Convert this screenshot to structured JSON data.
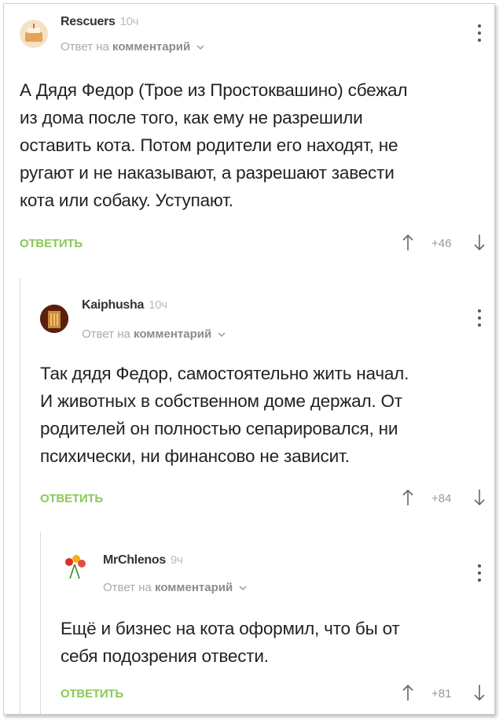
{
  "comments": [
    {
      "author": "Rescuers",
      "time": "10ч",
      "reply_prefix": "Ответ на",
      "reply_target": "комментарий",
      "lines": [
        "А Дядя Федор (Трое из Простоквашино) сбежал",
        "из дома после того, как ему не разрешили",
        "оставить кота. Потом родители его находят, не",
        "ругают и не наказывают, а разрешают завести",
        "кота или собаку. Уступают."
      ],
      "reply_label": "ОТВЕТИТЬ",
      "rating": "+46"
    },
    {
      "author": "Kaiphusha",
      "time": "10ч",
      "reply_prefix": "Ответ на",
      "reply_target": "комментарий",
      "lines": [
        "Так дядя Федор, самостоятельно жить начал.",
        "И животных в собственном доме держал. От",
        "родителей он полностью сепарировался, ни",
        "психически, ни финансово не зависит."
      ],
      "reply_label": "ОТВЕТИТЬ",
      "rating": "+84"
    },
    {
      "author": "MrChlenos",
      "time": "9ч",
      "reply_prefix": "Ответ на",
      "reply_target": "комментарий",
      "lines": [
        "Ещё и бизнес на кота оформил, что бы от",
        "себя подозрения отвести."
      ],
      "reply_label": "ОТВЕТИТЬ",
      "rating": "+81"
    }
  ],
  "colors": {
    "reply_green": "#8ac858",
    "text": "#222222",
    "muted": "#aaaaaa"
  }
}
